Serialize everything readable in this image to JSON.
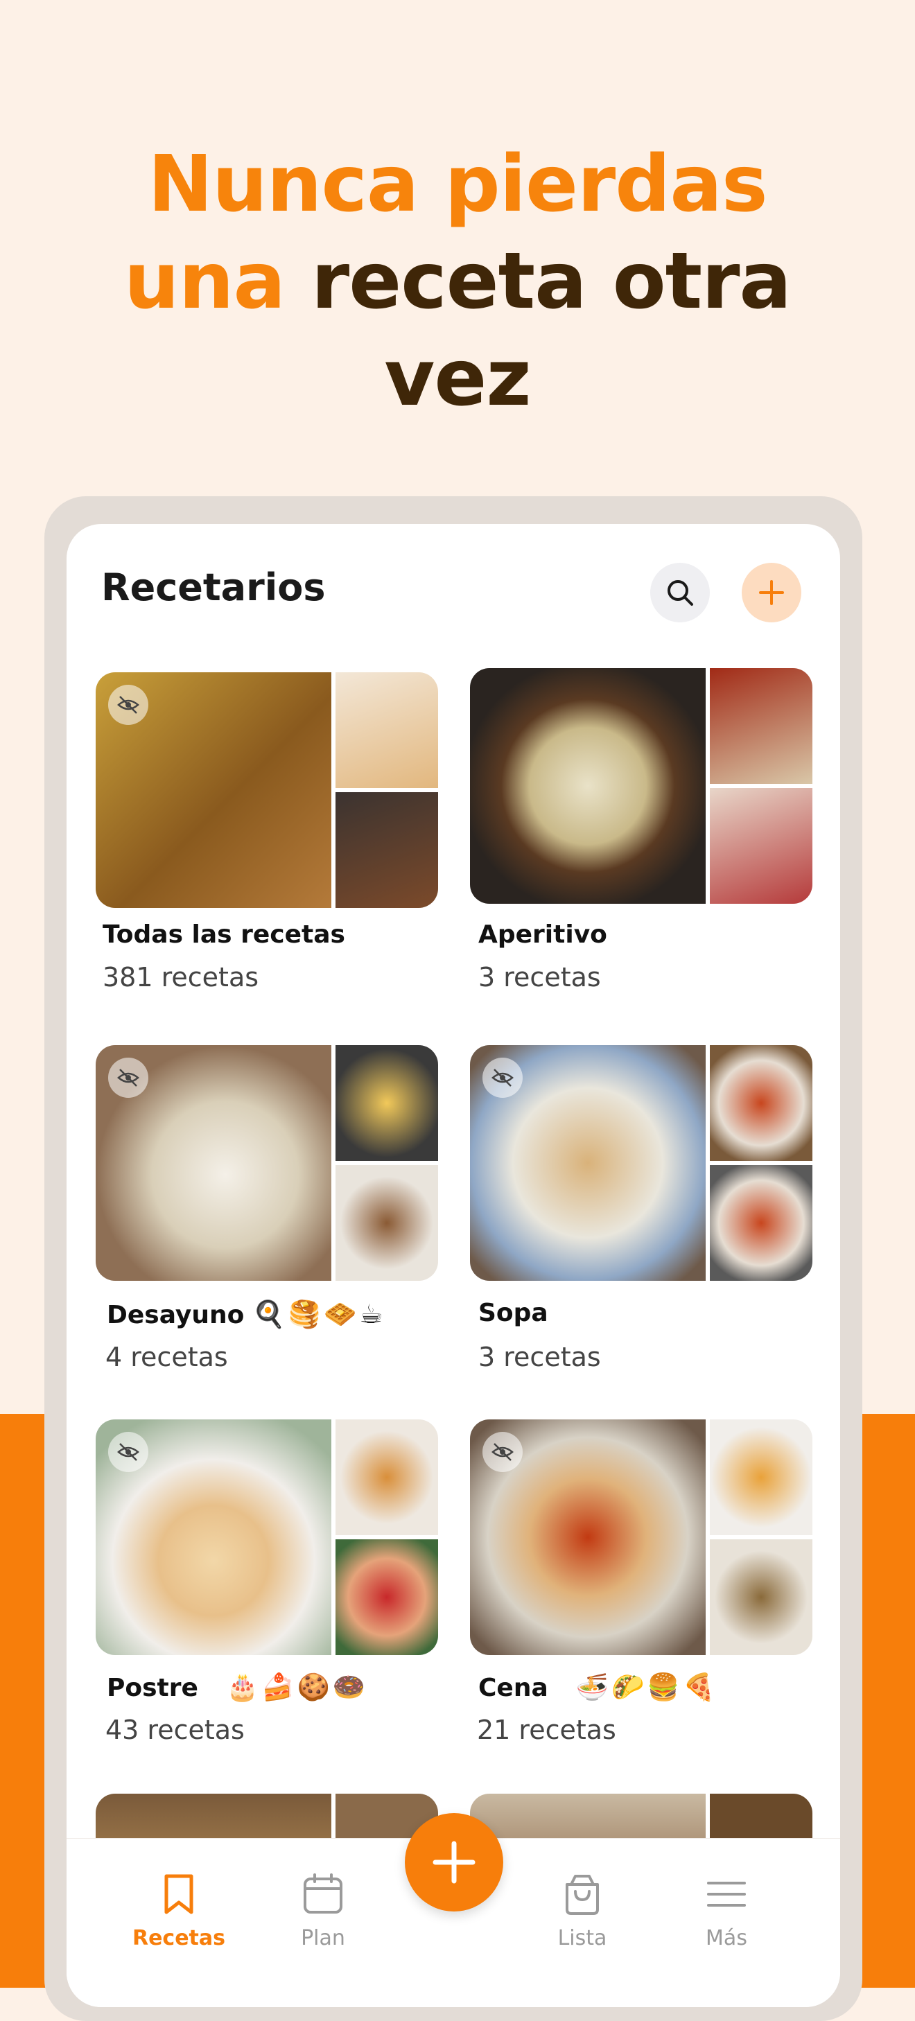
{
  "headline": {
    "line1": "Nunca pierdas",
    "line2_orange": "una",
    "line2_brown": "receta otra",
    "line3": "vez"
  },
  "header": {
    "title": "Recetarios",
    "search_icon": "search-icon",
    "add_icon": "plus-icon"
  },
  "cookbooks": [
    {
      "name": "Todas las recetas",
      "emoji": "",
      "count": "381 recetas"
    },
    {
      "name": "Aperitivo",
      "emoji": "",
      "count": "3 recetas"
    },
    {
      "name": "Desayuno",
      "emoji": "🍳🥞🧇☕",
      "count": "4 recetas"
    },
    {
      "name": "Sopa",
      "emoji": "",
      "count": "3 recetas"
    },
    {
      "name": "Postre",
      "emoji": "🎂🍰🍪🍩",
      "count": "43 recetas"
    },
    {
      "name": "Cena",
      "emoji": "🍜🌮🍔🍕",
      "count": "21 recetas"
    }
  ],
  "tabbar": {
    "tabs": [
      {
        "label": "Recetas",
        "icon": "bookmark-icon",
        "active": true
      },
      {
        "label": "Plan",
        "icon": "calendar-icon",
        "active": false
      },
      {
        "label": "Lista",
        "icon": "shopping-bag-icon",
        "active": false
      },
      {
        "label": "Más",
        "icon": "menu-icon",
        "active": false
      }
    ],
    "fab_icon": "plus-icon"
  },
  "colors": {
    "accent": "#F77E0B",
    "brown": "#3F2608",
    "background": "#FDF1E7"
  }
}
